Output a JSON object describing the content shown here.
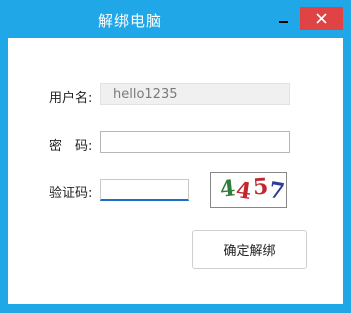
{
  "window": {
    "title": "解绑电脑",
    "accent_color": "#1fa7e8",
    "close_color": "#e04343"
  },
  "form": {
    "username_label": "用户名:",
    "username_value": "hello1235",
    "password_label": "密　码:",
    "password_value": "",
    "captcha_label": "验证码:",
    "captcha_value": "",
    "captcha_image_text": [
      "4",
      "4",
      "5",
      "7"
    ]
  },
  "actions": {
    "confirm_label": "确定解绑"
  },
  "icons": {
    "minimize": "minimize-icon",
    "close": "close-icon"
  }
}
